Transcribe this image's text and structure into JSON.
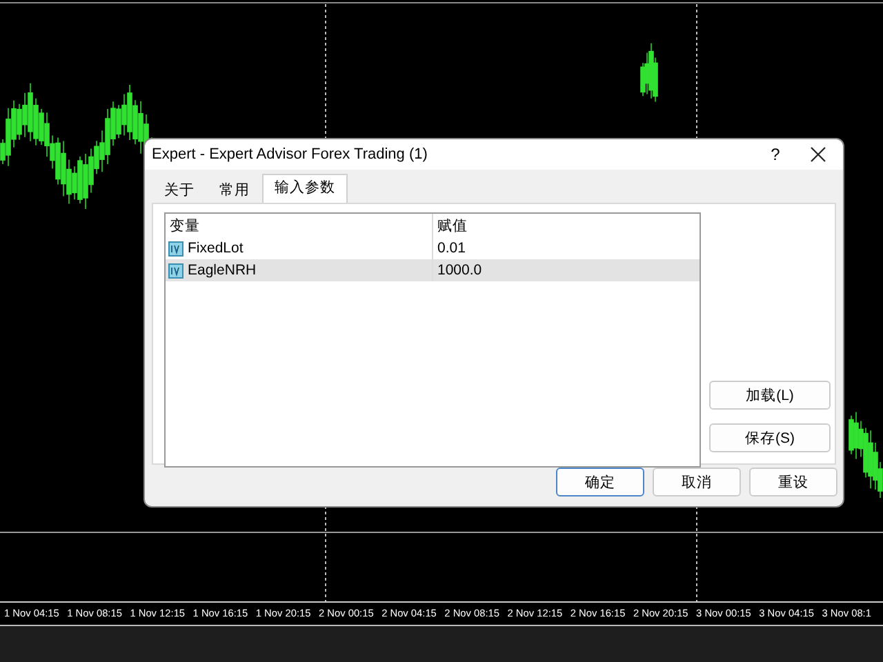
{
  "chart": {
    "time_axis": [
      "1 Nov 04:15",
      "1 Nov 08:15",
      "1 Nov 12:15",
      "1 Nov 16:15",
      "1 Nov 20:15",
      "2 Nov 00:15",
      "2 Nov 04:15",
      "2 Nov 08:15",
      "2 Nov 12:15",
      "2 Nov 16:15",
      "2 Nov 20:15",
      "3 Nov 00:15",
      "3 Nov 04:15",
      "3 Nov 08:1"
    ]
  },
  "dialog": {
    "title": "Expert - Expert Advisor Forex Trading (1)",
    "help_button": "?",
    "tabs": [
      {
        "label": "关于",
        "selected": false
      },
      {
        "label": "常用",
        "selected": false
      },
      {
        "label": "输入参数",
        "selected": true
      }
    ],
    "table": {
      "columns": [
        "变量",
        "赋值"
      ],
      "rows": [
        {
          "name": "FixedLot",
          "value": "0.01",
          "selected": false
        },
        {
          "name": "EagleNRH",
          "value": "1000.0",
          "selected": true
        }
      ]
    },
    "side_buttons": [
      "加载(L)",
      "保存(S)"
    ],
    "buttons": [
      {
        "label": "确定",
        "default": true
      },
      {
        "label": "取消",
        "default": false
      },
      {
        "label": "重设",
        "default": false
      }
    ]
  }
}
